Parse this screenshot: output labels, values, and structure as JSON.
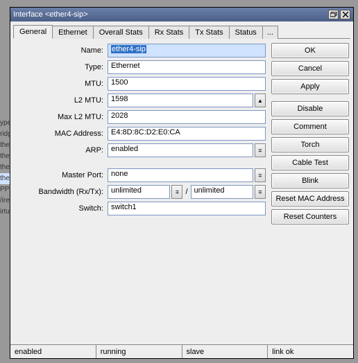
{
  "window": {
    "title": "Interface <ether4-sip>"
  },
  "tabs": [
    "General",
    "Ethernet",
    "Overall Stats",
    "Rx Stats",
    "Tx Stats",
    "Status",
    "..."
  ],
  "buttons": {
    "ok": "OK",
    "cancel": "Cancel",
    "apply": "Apply",
    "disable": "Disable",
    "comment": "Comment",
    "torch": "Torch",
    "cable_test": "Cable Test",
    "blink": "Blink",
    "reset_mac": "Reset MAC Address",
    "reset_counters": "Reset Counters"
  },
  "form": {
    "name_label": "Name:",
    "name": "ether4-sip",
    "type_label": "Type:",
    "type": "Ethernet",
    "mtu_label": "MTU:",
    "mtu": "1500",
    "l2mtu_label": "L2 MTU:",
    "l2mtu": "1598",
    "maxl2_label": "Max L2 MTU:",
    "maxl2": "2028",
    "mac_label": "MAC Address:",
    "mac": "E4:8D:8C:D2:E0:CA",
    "arp_label": "ARP:",
    "arp": "enabled",
    "master_label": "Master Port:",
    "master": "none",
    "bw_label": "Bandwidth (Rx/Tx):",
    "bw_rx": "unlimited",
    "bw_tx": "unlimited",
    "switch_label": "Switch:",
    "switch": "switch1"
  },
  "status": {
    "c1": "enabled",
    "c2": "running",
    "c3": "slave",
    "c4": "link ok"
  },
  "ghost": [
    "ype",
    "ridg",
    "ther",
    "ther",
    "ther",
    "the",
    "PP",
    "/ire",
    "irtu"
  ]
}
